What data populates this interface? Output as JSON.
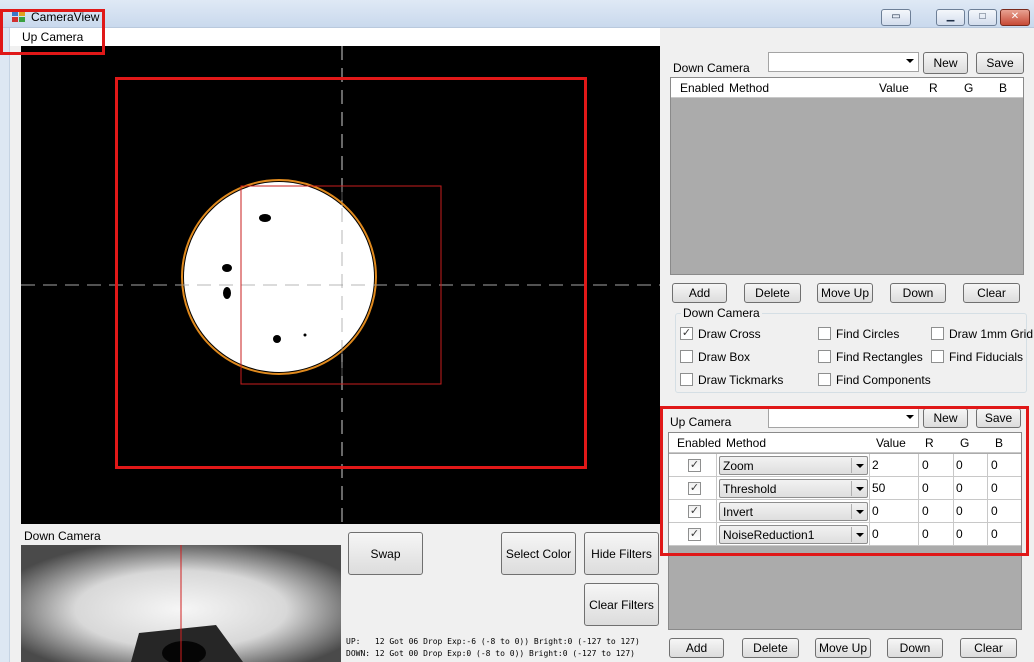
{
  "window": {
    "title": "CameraView"
  },
  "menu": {
    "item": "Up Camera"
  },
  "down_panel": {
    "title": "Down Camera",
    "new_label": "New",
    "save_label": "Save",
    "columns": [
      "Enabled",
      "Method",
      "Value",
      "R",
      "G",
      "B"
    ],
    "buttons": {
      "add": "Add",
      "delete": "Delete",
      "move_up": "Move Up",
      "down": "Down",
      "clear": "Clear"
    },
    "options_title": "Down Camera",
    "options": [
      {
        "label": "Draw Cross",
        "checked": true
      },
      {
        "label": "Find Circles",
        "checked": false
      },
      {
        "label": "Draw 1mm Grid",
        "checked": false
      },
      {
        "label": "Draw Box",
        "checked": false
      },
      {
        "label": "Find Rectangles",
        "checked": false
      },
      {
        "label": "Find Fiducials",
        "checked": false
      },
      {
        "label": "Draw Tickmarks",
        "checked": false
      },
      {
        "label": "Find Components",
        "checked": false
      }
    ]
  },
  "up_panel": {
    "title": "Up Camera",
    "new_label": "New",
    "save_label": "Save",
    "columns": [
      "Enabled",
      "Method",
      "Value",
      "R",
      "G",
      "B"
    ],
    "rows": [
      {
        "enabled": true,
        "method": "Zoom",
        "value": "2",
        "r": "0",
        "g": "0",
        "b": "0"
      },
      {
        "enabled": true,
        "method": "Threshold",
        "value": "50",
        "r": "0",
        "g": "0",
        "b": "0"
      },
      {
        "enabled": true,
        "method": "Invert",
        "value": "0",
        "r": "0",
        "g": "0",
        "b": "0"
      },
      {
        "enabled": true,
        "method": "NoiseReduction1",
        "value": "0",
        "r": "0",
        "g": "0",
        "b": "0"
      }
    ],
    "buttons": {
      "add": "Add",
      "delete": "Delete",
      "move_up": "Move Up",
      "down": "Down",
      "clear": "Clear"
    }
  },
  "down_camera_label": "Down Camera",
  "actions": {
    "swap": "Swap",
    "select_color": "Select Color",
    "hide_filters": "Hide Filters",
    "clear_filters": "Clear Filters"
  },
  "status": {
    "up": "UP:   12 Got 06 Drop Exp:-6 (-8 to 0)) Bright:0 (-127 to 127)",
    "down": "DOWN: 12 Got 00 Drop Exp:0 (-8 to 0)) Bright:0 (-127 to 127)"
  },
  "colors": {
    "highlight": "#e01818",
    "grid_bg": "#ababab",
    "circle_outline": "#e08a1e"
  }
}
